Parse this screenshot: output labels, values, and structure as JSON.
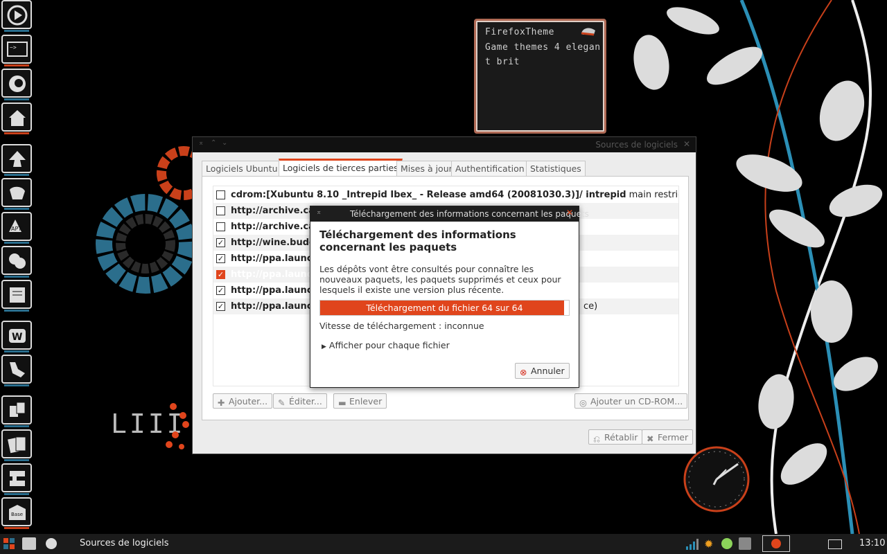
{
  "desktop": {
    "note": {
      "lines": [
        "FirefoxTheme",
        "Game themes 4 elegan",
        "t brit"
      ]
    }
  },
  "window": {
    "title": "Sources de logiciels",
    "tabs": [
      {
        "label": "Logiciels Ubuntu",
        "active": false
      },
      {
        "label": "Logiciels de tierces parties",
        "active": true
      },
      {
        "label": "Mises à jour",
        "active": false
      },
      {
        "label": "Authentification",
        "active": false
      },
      {
        "label": "Statistiques",
        "active": false
      }
    ],
    "sources": [
      {
        "bold": "cdrom:[Xubuntu 8.10 _Intrepid Ibex_ - Release amd64 (20081030.3)]/ intrepid",
        "rest": " main restricted",
        "checked": false
      },
      {
        "bold": "http://archive.ca",
        "rest": "",
        "checked": false
      },
      {
        "bold": "http://archive.ca",
        "rest": "",
        "checked": false
      },
      {
        "bold": "http://wine.budg",
        "rest": "",
        "checked": true
      },
      {
        "bold": "http://ppa.launch",
        "rest": "",
        "checked": true
      },
      {
        "bold": "http://ppa.launc",
        "rest": "",
        "checked": true,
        "selected": true
      },
      {
        "bold": "http://ppa.launch",
        "rest": "",
        "checked": true
      },
      {
        "bold": "http://ppa.launch",
        "rest": "ce)",
        "checked": true
      }
    ],
    "buttons": {
      "add": "Ajouter...",
      "edit": "Éditer...",
      "remove": "Enlever",
      "add_cdrom": "Ajouter un CD-ROM...",
      "revert": "Rétablir",
      "close": "Fermer"
    }
  },
  "dialog": {
    "title": "Téléchargement des informations concernant les paquets",
    "heading": "Téléchargement des informations concernant les paquets",
    "description": "Les dépôts vont être consultés pour connaître les nouveaux paquets, les paquets supprimés et ceux pour lesquels il existe une version plus récente.",
    "progress_text": "Téléchargement du fichier 64 sur 64",
    "progress_fraction": 0.98,
    "speed": "Vitesse de téléchargement : inconnue",
    "details": "Afficher pour chaque fichier",
    "cancel": "Annuler"
  },
  "taskbar": {
    "task": "Sources de logiciels",
    "clock": "13:10"
  },
  "colors": {
    "accent": "#e0451c",
    "dock_bar": "#2a6f8f"
  }
}
